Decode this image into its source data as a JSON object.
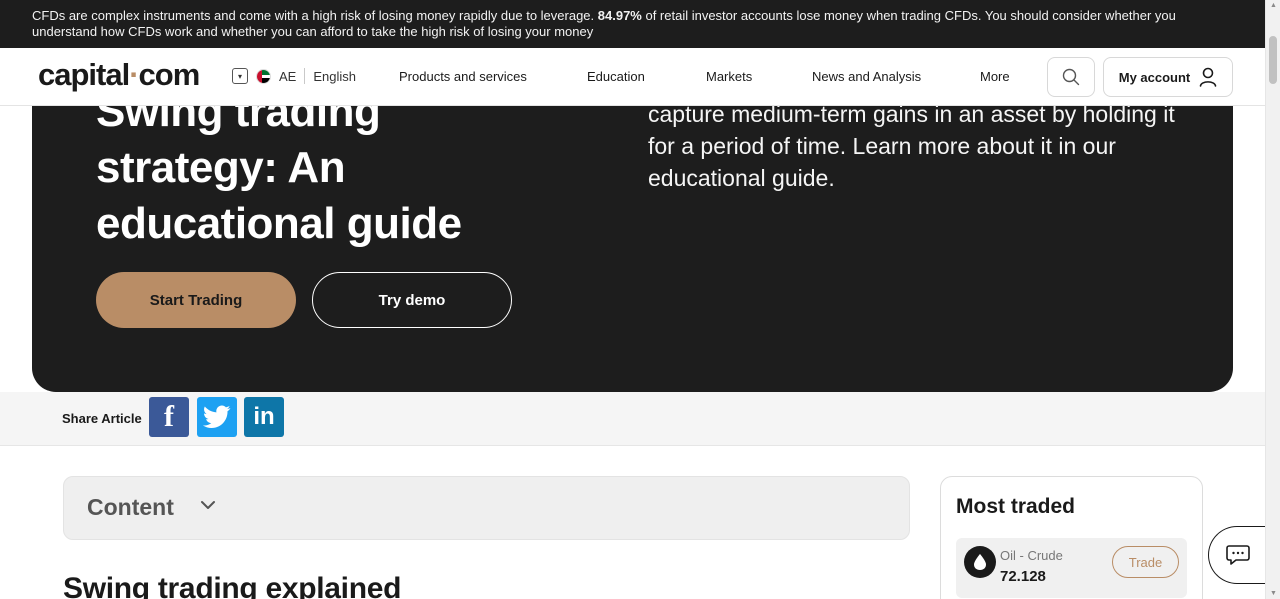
{
  "risk_banner": {
    "text_before": "CFDs are complex instruments and come with a high risk of losing money rapidly due to leverage. ",
    "percent": "84.97%",
    "text_after": " of retail investor accounts lose money when trading CFDs. You should consider whether you understand how CFDs work and whether you can afford to take the high risk of losing your money"
  },
  "nav": {
    "logo_left": "capital",
    "logo_dot": "·",
    "logo_right": "com",
    "region": "AE",
    "language": "English",
    "items": [
      "Products and services",
      "Education",
      "Markets",
      "News and Analysis",
      "More"
    ],
    "account_label": "My account",
    "icons": {
      "search": "search-icon",
      "account": "user-icon",
      "dropdown": "chevron-down-icon"
    }
  },
  "hero": {
    "title": "Swing trading strategy: An educational guide",
    "description": "Swing trading is a style of trading that attempts to capture medium-term gains in an asset by holding it for a period of time. Learn more about it in our educational guide.",
    "primary_button": "Start Trading",
    "secondary_button": "Try demo"
  },
  "share": {
    "label": "Share Article",
    "icons": [
      "facebook-icon",
      "twitter-icon",
      "linkedin-icon"
    ],
    "facebook_glyph": "f",
    "linkedin_glyph": "in"
  },
  "content": {
    "title": "Content",
    "section_heading": "Swing trading explained"
  },
  "most_traded": {
    "title": "Most traded",
    "items": [
      {
        "name": "Oil - Crude",
        "price": "72.128",
        "button": "Trade"
      }
    ]
  },
  "colors": {
    "accent": "#b98d66",
    "dark": "#1d1d1d",
    "facebook": "#3b5998",
    "twitter": "#1da1f2",
    "linkedin": "#0e76a8"
  }
}
